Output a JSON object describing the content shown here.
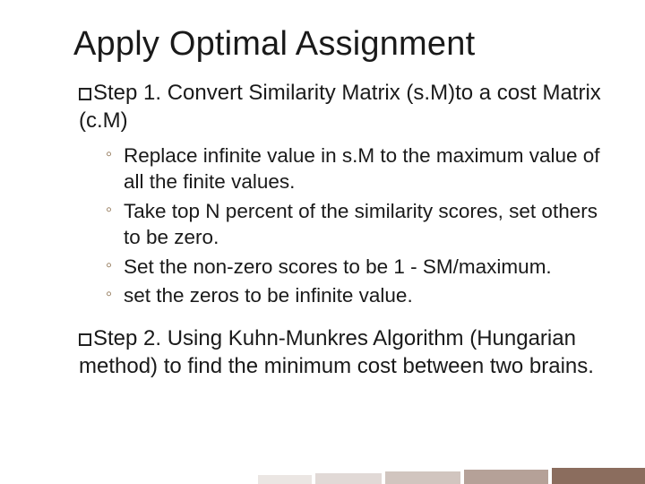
{
  "title": "Apply Optimal Assignment",
  "step1": {
    "text": "Step 1. Convert Similarity Matrix (s.M)to a cost Matrix (c.M)",
    "subs": [
      "Replace infinite value in s.M to the maximum value of all the finite values.",
      "Take top N percent of the similarity scores, set others to be zero.",
      "Set the non-zero scores to be 1 - SM/maximum.",
      "set the zeros to be infinite value."
    ]
  },
  "step2": {
    "text": "Step 2. Using Kuhn-Munkres Algorithm (Hungarian method) to find the minimum cost  between two brains."
  }
}
